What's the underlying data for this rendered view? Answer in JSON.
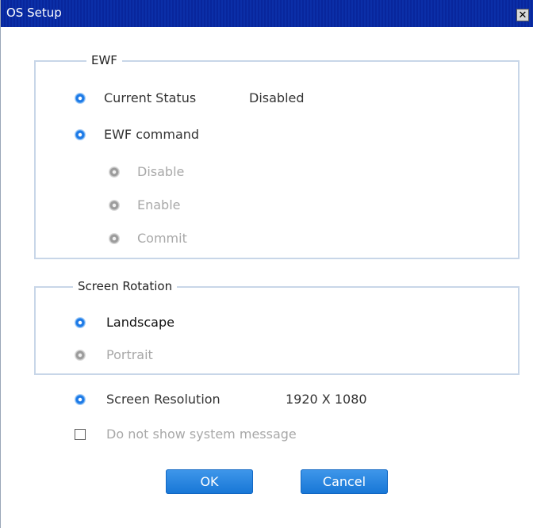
{
  "window": {
    "title": "OS Setup",
    "close_glyph": "✕"
  },
  "ewf": {
    "legend": "EWF",
    "current_status_label": "Current Status",
    "current_status_value": "Disabled",
    "command_label": "EWF command",
    "commands": [
      "Disable",
      "Enable",
      "Commit"
    ]
  },
  "rotation": {
    "legend": "Screen Rotation",
    "options": [
      "Landscape",
      "Portrait"
    ]
  },
  "resolution": {
    "label": "Screen Resolution",
    "value": "1920 X 1080"
  },
  "system_message": {
    "label": "Do not show system message",
    "checked": false
  },
  "buttons": {
    "ok": "OK",
    "cancel": "Cancel"
  },
  "colors": {
    "title_bar": "#0b2fa8",
    "radio_active": "#1e7ae6",
    "radio_disabled": "#9c9c9c",
    "button": "#1776d6",
    "group_border": "#c8d6e8"
  }
}
